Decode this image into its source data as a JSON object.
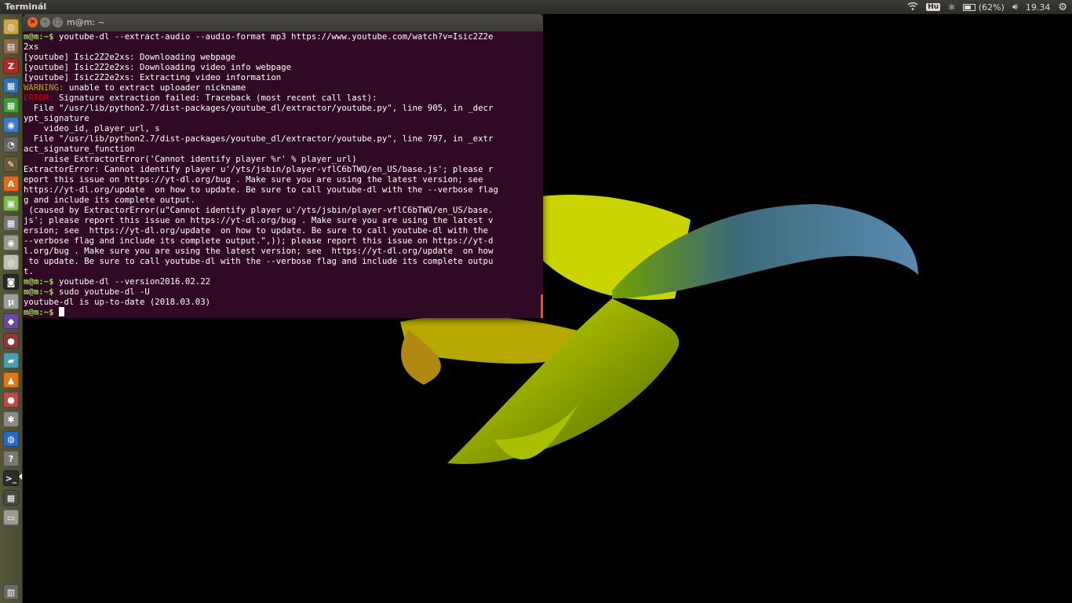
{
  "panel": {
    "title": "Terminál",
    "keyboard": "Hu",
    "battery": "(62%)",
    "time": "19.34"
  },
  "terminal": {
    "title": "m@m: ~",
    "lines": [
      {
        "type": "prompt",
        "prompt": "m@m:~$",
        "text": " youtube-dl --extract-audio --audio-format mp3 https://www.youtube.com/watch?v=Isic2Z2e"
      },
      {
        "type": "text",
        "text": "2xs"
      },
      {
        "type": "text",
        "text": "[youtube] Isic2Z2e2xs: Downloading webpage"
      },
      {
        "type": "text",
        "text": "[youtube] Isic2Z2e2xs: Downloading video info webpage"
      },
      {
        "type": "text",
        "text": "[youtube] Isic2Z2e2xs: Extracting video information"
      },
      {
        "type": "warning",
        "label": "WARNING:",
        "text": " unable to extract uploader nickname"
      },
      {
        "type": "error",
        "label": "ERROR:",
        "text": " Signature extraction failed: Traceback (most recent call last):"
      },
      {
        "type": "text",
        "text": "  File \"/usr/lib/python2.7/dist-packages/youtube_dl/extractor/youtube.py\", line 905, in _decr"
      },
      {
        "type": "text",
        "text": "ypt_signature"
      },
      {
        "type": "text",
        "text": "    video_id, player_url, s"
      },
      {
        "type": "text",
        "text": "  File \"/usr/lib/python2.7/dist-packages/youtube_dl/extractor/youtube.py\", line 797, in _extr"
      },
      {
        "type": "text",
        "text": "act_signature_function"
      },
      {
        "type": "text",
        "text": "    raise ExtractorError('Cannot identify player %r' % player_url)"
      },
      {
        "type": "text",
        "text": "ExtractorError: Cannot identify player u'/yts/jsbin/player-vflC6bTWQ/en_US/base.js'; please r"
      },
      {
        "type": "text",
        "text": "eport this issue on https://yt-dl.org/bug . Make sure you are using the latest version; see"
      },
      {
        "type": "text",
        "text": "https://yt-dl.org/update  on how to update. Be sure to call youtube-dl with the --verbose flag"
      },
      {
        "type": "text",
        "text": "g and include its complete output."
      },
      {
        "type": "text",
        "text": " (caused by ExtractorError(u\"Cannot identify player u'/yts/jsbin/player-vflC6bTWQ/en_US/base."
      },
      {
        "type": "text",
        "text": "js'; please report this issue on https://yt-dl.org/bug . Make sure you are using the latest v"
      },
      {
        "type": "text",
        "text": "ersion; see  https://yt-dl.org/update  on how to update. Be sure to call youtube-dl with the"
      },
      {
        "type": "text",
        "text": "--verbose flag and include its complete output.\",)); please report this issue on https://yt-d"
      },
      {
        "type": "text",
        "text": "l.org/bug . Make sure you are using the latest version; see  https://yt-dl.org/update  on how"
      },
      {
        "type": "text",
        "text": " to update. Be sure to call youtube-dl with the --verbose flag and include its complete outpu"
      },
      {
        "type": "text",
        "text": "t."
      },
      {
        "type": "prompt",
        "prompt": "m@m:~$",
        "text": " youtube-dl --version2016.02.22"
      },
      {
        "type": "prompt",
        "prompt": "m@m:~$",
        "text": " sudo youtube-dl -U"
      },
      {
        "type": "text",
        "text": "youtube-dl is up-to-date (2018.03.03)"
      },
      {
        "type": "cursor",
        "prompt": "m@m:~$",
        "text": " "
      }
    ]
  },
  "launcher": {
    "items": [
      {
        "name": "dash-home-icon",
        "color": "#c8a84a",
        "glyph": "◎"
      },
      {
        "name": "files-icon",
        "color": "#8a6a4a",
        "glyph": "▤"
      },
      {
        "name": "filezilla-icon",
        "color": "#b02a2a",
        "glyph": "Z"
      },
      {
        "name": "writer-icon",
        "color": "#2f6fb5",
        "glyph": "▦"
      },
      {
        "name": "calc-icon",
        "color": "#3f9a3f",
        "glyph": "▦"
      },
      {
        "name": "browser-icon",
        "color": "#3a7ac8",
        "glyph": "◉"
      },
      {
        "name": "eye-of-gnome-icon",
        "color": "#666666",
        "glyph": "◔"
      },
      {
        "name": "editor-icon",
        "color": "#6a5a3a",
        "glyph": "✎"
      },
      {
        "name": "software-center-icon",
        "color": "#e06a20",
        "glyph": "A"
      },
      {
        "name": "android-icon",
        "color": "#7ab84a",
        "glyph": "▣"
      },
      {
        "name": "calculator-icon",
        "color": "#777777",
        "glyph": "▦"
      },
      {
        "name": "disc-icon",
        "color": "#9a9a8a",
        "glyph": "◉"
      },
      {
        "name": "dvd-icon",
        "color": "#bdbdb0",
        "glyph": "◎"
      },
      {
        "name": "webcam-icon",
        "color": "#2a2a2a",
        "glyph": "◙"
      },
      {
        "name": "mu-icon",
        "color": "#9aa09a",
        "glyph": "μ"
      },
      {
        "name": "game-icon",
        "color": "#6a4a9a",
        "glyph": "◆"
      },
      {
        "name": "joystick-icon",
        "color": "#8a3a3a",
        "glyph": "●"
      },
      {
        "name": "image-viewer-icon",
        "color": "#4aa0b0",
        "glyph": "▰"
      },
      {
        "name": "vlc-icon",
        "color": "#e07a10",
        "glyph": "▲"
      },
      {
        "name": "media-player-icon",
        "color": "#c04a4a",
        "glyph": "●"
      },
      {
        "name": "settings-icon",
        "color": "#8a8a8a",
        "glyph": "✱"
      },
      {
        "name": "globe-icon",
        "color": "#2a6ac0",
        "glyph": "◍"
      },
      {
        "name": "help-icon",
        "color": "#7a7a72",
        "glyph": "?"
      },
      {
        "name": "terminal-icon",
        "color": "#2c2c2c",
        "glyph": ">_",
        "active": true
      },
      {
        "name": "workspace-switcher-icon",
        "color": "#4a4a44",
        "glyph": "▦"
      },
      {
        "name": "drive-icon",
        "color": "#9a9a90",
        "glyph": "▭"
      },
      {
        "name": "trash-icon",
        "color": "#6a6a62",
        "glyph": "▥"
      }
    ]
  }
}
